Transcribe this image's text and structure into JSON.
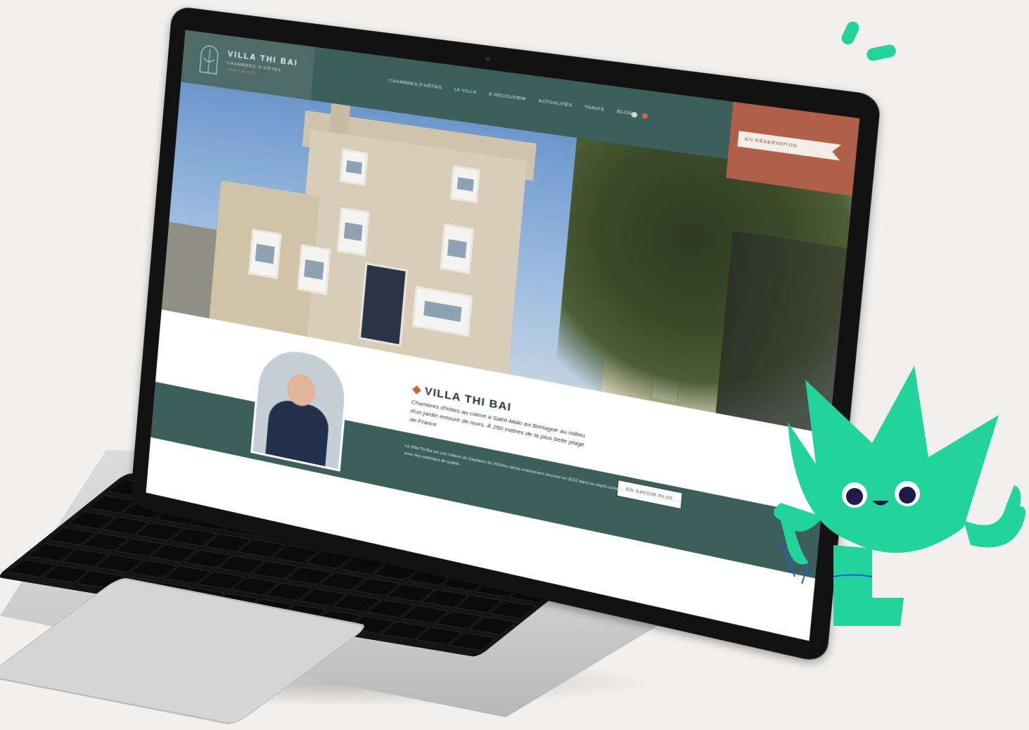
{
  "site": {
    "logo_title": "VILLA THI BAI",
    "logo_subtitle": "CHAMBRES D'HÔTES",
    "logo_tagline": "SAINT-MALO",
    "nav": [
      "CHAMBRES D'HÔTES",
      "LA VILLA",
      "À DÉCOUVRIR",
      "ACTUALITÉS",
      "TARIFS",
      "BLOG"
    ],
    "reserve_label": "EN RÉSERVATION",
    "intro": {
      "title": "VILLA THI BAI",
      "text": "Chambres d'hôtes au calme à Saint-Malo en Bretagne au milieu d'un jardin entouré de murs. À 250 mètres de la plus belle plage de France",
      "button": "EN SAVOIR PLUS",
      "band_text": "La Villa Thi Bai est une maison de Capitaine du XIXème siècle entièrement rénovée en 2022 dans un esprit contemporain par des artisans locaux avec des matériaux de qualité."
    }
  },
  "colors": {
    "header": "#3d5f5c",
    "accent": "#b0604a",
    "mascot": "#22d39b"
  }
}
